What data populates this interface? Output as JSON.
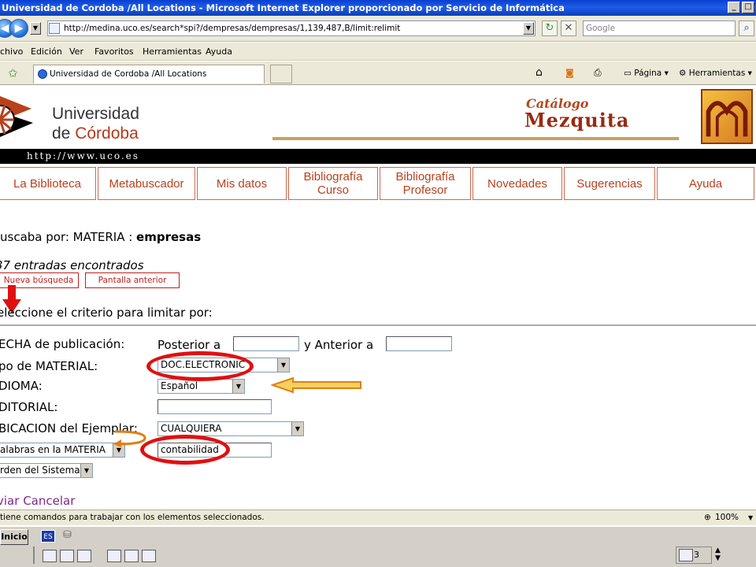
{
  "window": {
    "title": "Universidad de Cordoba /All Locations - Microsoft Internet Explorer proporcionado por Servicio de Informática",
    "buttons": [
      "_",
      "□"
    ]
  },
  "address_bar": {
    "url": "http://medina.uco.es/search*spi?/dempresas/dempresas/1,139,487,B/limit:relimit",
    "search_placeholder": "Google"
  },
  "menu": {
    "items": [
      "chivo",
      "Edición",
      "Ver",
      "Favoritos",
      "Herramientas",
      "Ayuda"
    ]
  },
  "tabs": {
    "active_tab": "Universidad de Cordoba /All Locations",
    "tools": [
      "Página",
      "Herramientas"
    ]
  },
  "banner": {
    "uni_line1": "Universidad",
    "uni_line2_a": "de ",
    "uni_line2_b": "Córdoba",
    "url_text": "http://www.uco.es",
    "catalog_word": "Catálogo",
    "catalog_name": "Mezquita"
  },
  "nav": {
    "items": [
      "La Biblioteca",
      "Metabuscador",
      "Mis datos",
      "Bibliografía\nCurso",
      "Bibliografía\nProfesor",
      "Novedades",
      "Sugerencias",
      "Ayuda"
    ]
  },
  "search": {
    "prefix": "uscaba por: MATERIA : ",
    "term": "empresas",
    "entries": "37 entradas encontrados",
    "new_search_button": "Nueva búsqueda",
    "previous_button": "Pantalla anterior",
    "limit_heading": "eleccione el criterio para limitar por:"
  },
  "form": {
    "fecha_label": "ECHA de publicación:",
    "posterior_label": "Posterior a",
    "posterior_value": "",
    "anterior_label": "y Anterior a",
    "anterior_value": "",
    "tipo_label": "po de MATERIAL:",
    "tipo_value": "DOC.ELECTRONIC",
    "idioma_label": "DIOMA:",
    "idioma_value": "Español",
    "editorial_label": "DITORIAL:",
    "editorial_value": "",
    "ubicacion_label": "BICACION del Ejemplar:",
    "ubicacion_value": "CUALQUIERA",
    "palabras_select": "alabras en la MATERIA",
    "palabras_value": "contabilidad",
    "orden_select": "rden del Sistema",
    "enviar_link": "viar",
    "cancelar_link": "Cancelar"
  },
  "statusbar": {
    "text": "tiene comandos para trabajar con los elementos seleccionados.",
    "zoom": "100%"
  },
  "taskbar": {
    "start_label": "Inicio",
    "lang": "ES",
    "tray_count": "3"
  },
  "annotation_colors": {
    "ellipse": "#e01010",
    "arrow_fill": "#f5d060",
    "arrow_outline": "#e08010",
    "down_arrow": "#e01010"
  }
}
